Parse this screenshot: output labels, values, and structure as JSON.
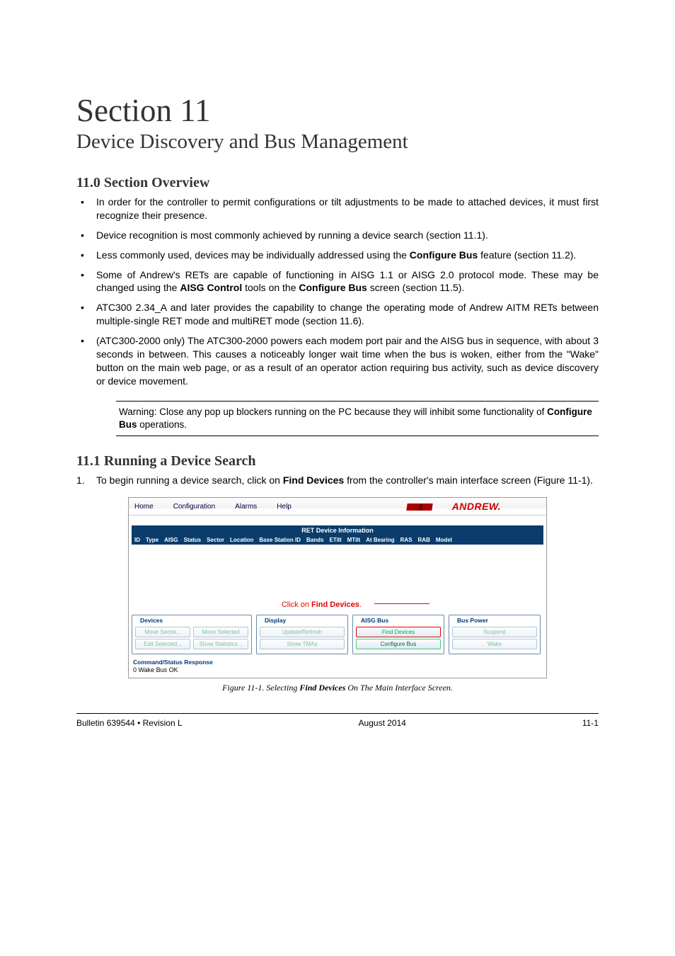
{
  "section_number": "Section 11",
  "section_title": "Device Discovery and Bus Management",
  "overview": {
    "heading": "11.0 Section Overview",
    "bullets": [
      "In order for the controller to permit configurations or tilt adjustments to be made to attached devices, it must first recognize their presence.",
      "Device recognition is most commonly achieved by running a device search (section 11.1).",
      "Less commonly used, devices may be individually addressed using the <b>Configure Bus</b> feature (section 11.2).",
      "Some of Andrew's RETs are capable of functioning in AISG 1.1 or AISG 2.0 protocol mode.  These may be changed using the <b>AISG Control</b> tools on the <b>Configure Bus</b> screen (section 11.5).",
      "ATC300 2.34_A and later provides the capability to change the operating mode of Andrew AITM RETs between multiple-single RET mode and multiRET mode (section 11.6).",
      "(ATC300-2000 only)  The ATC300-2000 powers each modem port pair and the AISG bus in sequence, with about 3 seconds in between.  This causes a noticeably longer wait time when the bus is woken, either from the \"Wake\" button on the main web page, or as a result of an operator action requiring bus activity, such as device discovery or device movement."
    ],
    "warning": "Warning: Close any pop up blockers running on the PC because they will inhibit some functionality of <b>Configure Bus</b> operations."
  },
  "search": {
    "heading": "11.1 Running a Device Search",
    "step1_num": "1.",
    "step1": "To begin running a device search, click on <b>Find Devices</b> from the controller's main interface screen (Figure 11-1)."
  },
  "figure": {
    "menubar": [
      "Home",
      "Configuration",
      "Alarms",
      "Help"
    ],
    "logo": "ANDREW.",
    "table_title": "RET Device Information",
    "columns": [
      "ID",
      "Type",
      "AISG",
      "Status",
      "Sector",
      "Location",
      "Base Station ID",
      "Bands",
      "ETilt",
      "MTilt",
      "At Bearing",
      "RAS",
      "RAB",
      "Model"
    ],
    "annotation": "Click on <b>Find Devices</b>.",
    "group_devices": {
      "legend": "Devices",
      "btn1": "Move Sector...",
      "btn2": "Edit Selected...",
      "btn3": "Move Selected",
      "btn4": "Show Statistics..."
    },
    "group_display": {
      "legend": "Display",
      "btn1": "Update/Refresh",
      "btn2": "Show TMAs"
    },
    "group_aisg": {
      "legend": "AISG Bus",
      "btn1": "Find Devices",
      "btn2": "Configure Bus"
    },
    "group_power": {
      "legend": "Bus Power",
      "btn1": "Suspend",
      "btn2": "Wake"
    },
    "status_label": "Command/Status Response",
    "status_text": "0 Wake Bus OK",
    "caption": "Figure 11-1.  Selecting <b>Find Devices</b> On The Main Interface Screen."
  },
  "footer": {
    "left": "Bulletin 639544  •  Revision L",
    "center": "August 2014",
    "right": "11-1"
  }
}
